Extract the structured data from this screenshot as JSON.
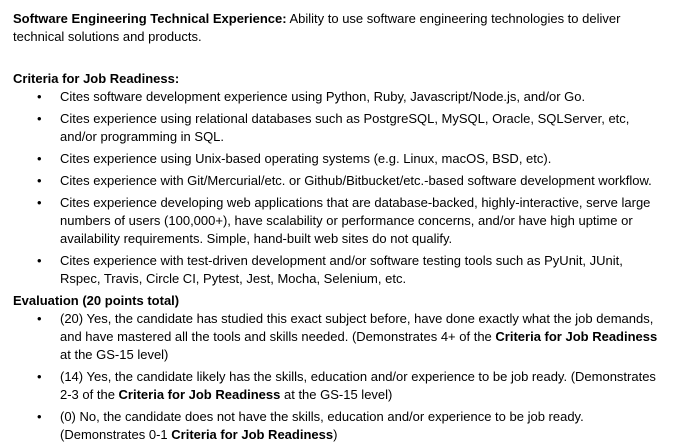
{
  "intro": {
    "label": "Software Engineering Technical Experience:",
    "text": " Ability to use software engineering technologies to deliver technical solutions and products."
  },
  "criteria": {
    "heading": "Criteria for Job Readiness:",
    "items": [
      "Cites software development experience using Python, Ruby, Javascript/Node.js, and/or Go.",
      "Cites experience using relational databases such as PostgreSQL, MySQL, Oracle, SQLServer, etc, and/or programming in SQL.",
      "Cites experience using Unix-based operating systems (e.g. Linux, macOS, BSD, etc).",
      "Cites experience with Git/Mercurial/etc. or Github/Bitbucket/etc.-based software development workflow.",
      "Cites experience developing web applications that are database-backed, highly-interactive, serve large numbers of users (100,000+), have scalability or performance concerns, and/or have high uptime or availability requirements. Simple, hand-built web sites do not qualify.",
      "Cites experience with test-driven development and/or software testing tools such as PyUnit, JUnit, Rspec, Travis, Circle CI, Pytest, Jest, Mocha, Selenium, etc."
    ]
  },
  "evaluation": {
    "heading": "Evaluation (20 points total)",
    "items": [
      {
        "pre": "(20) Yes, the candidate has studied this exact subject before, have done exactly what the job demands, and have mastered all the tools and skills needed. (Demonstrates 4+ of the ",
        "bold": "Criteria for Job Readiness",
        "post": " at the GS-15 level)"
      },
      {
        "pre": "(14) Yes, the candidate likely has the skills, education and/or experience to be job ready. (Demonstrates 2-3 of the ",
        "bold": "Criteria for Job Readiness",
        "post": " at the GS-15 level)"
      },
      {
        "pre": "(0) No, the candidate does not have the skills, education and/or experience to be job ready. (Demonstrates 0-1 ",
        "bold": "Criteria for Job Readiness",
        "post": ")"
      }
    ]
  }
}
